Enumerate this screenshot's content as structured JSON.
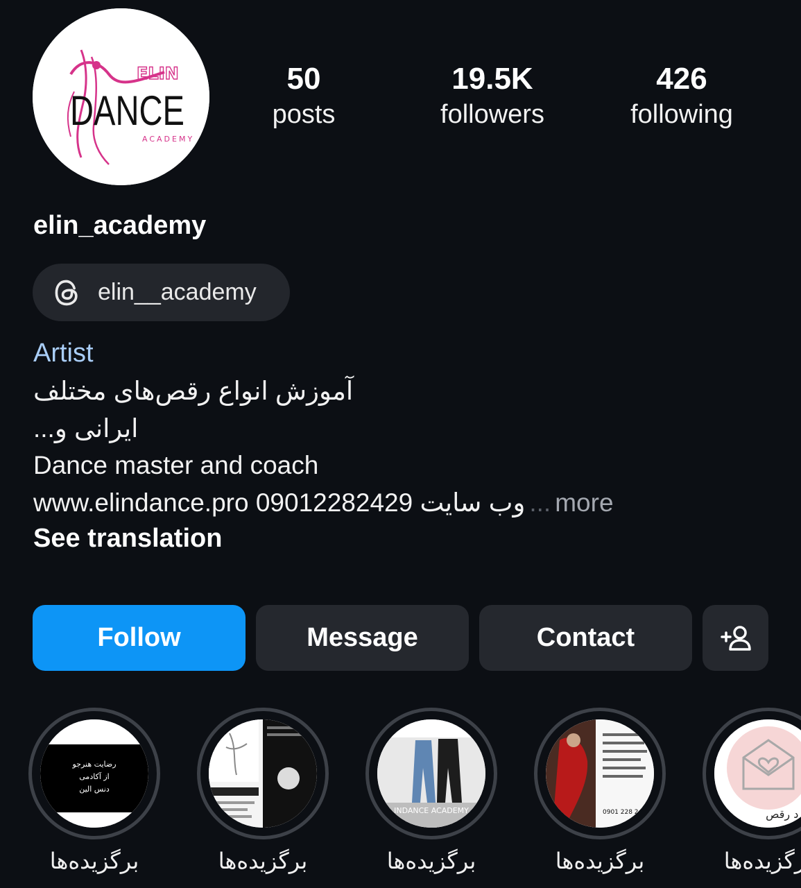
{
  "profile": {
    "avatar_logo_text": "ELIN DANCE ACADEMY",
    "username": "elin_academy",
    "threads_handle": "elin__academy",
    "category": "Artist",
    "bio_line1": "آموزش انواع رقص‌های مختلف",
    "bio_line2": "ایرانی و...",
    "bio_line3": "Dance master and coach",
    "bio_link": "www.elindance.pro 09012282429 وب سایت",
    "bio_ellipsis": "...",
    "more_label": "more",
    "see_translation": "See translation"
  },
  "stats": {
    "posts_count": "50",
    "posts_label": "posts",
    "followers_count": "19.5K",
    "followers_label": "followers",
    "following_count": "426",
    "following_label": "following"
  },
  "actions": {
    "follow": "Follow",
    "message": "Message",
    "contact": "Contact",
    "add_user_icon": "person-add-icon"
  },
  "highlights": [
    {
      "label": "برگزیده‌ها",
      "cover_text": "رضایت هنرجو از آکادمی دنس الین"
    },
    {
      "label": "برگزیده‌ها"
    },
    {
      "label": "برگزیده‌ها",
      "cover_text": "INDANCE ACADEMY"
    },
    {
      "label": "برگزیده‌ها",
      "cover_text": "0901 228 2"
    },
    {
      "label": "برگزیده‌ها",
      "cover_text": "مورد رقص"
    }
  ],
  "colors": {
    "background": "#0c0f14",
    "follow_button": "#0d95f6",
    "secondary_button": "#25282e",
    "category_text": "#a9cdf7",
    "brand_pink": "#d6338a"
  }
}
